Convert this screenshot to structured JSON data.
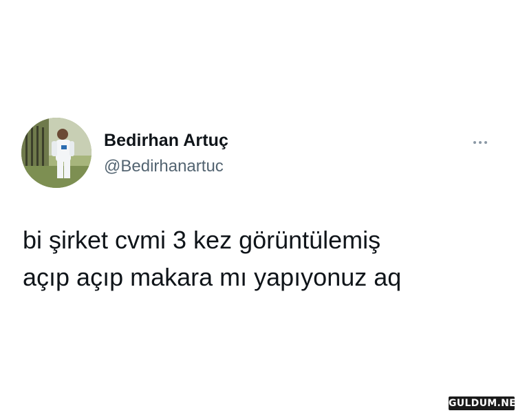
{
  "tweet": {
    "display_name": "Bedirhan Artuç",
    "handle": "@Bedirhanartuc",
    "text": "bi şirket cvmi 3 kez görüntülemiş\naçıp açıp makara mı yapıyonuz aq",
    "more_icon": "more-horizontal-icon"
  },
  "watermark": {
    "text": "GULDUM.NET"
  },
  "colors": {
    "text_primary": "#0f1419",
    "text_secondary": "#536471",
    "background": "#ffffff"
  }
}
